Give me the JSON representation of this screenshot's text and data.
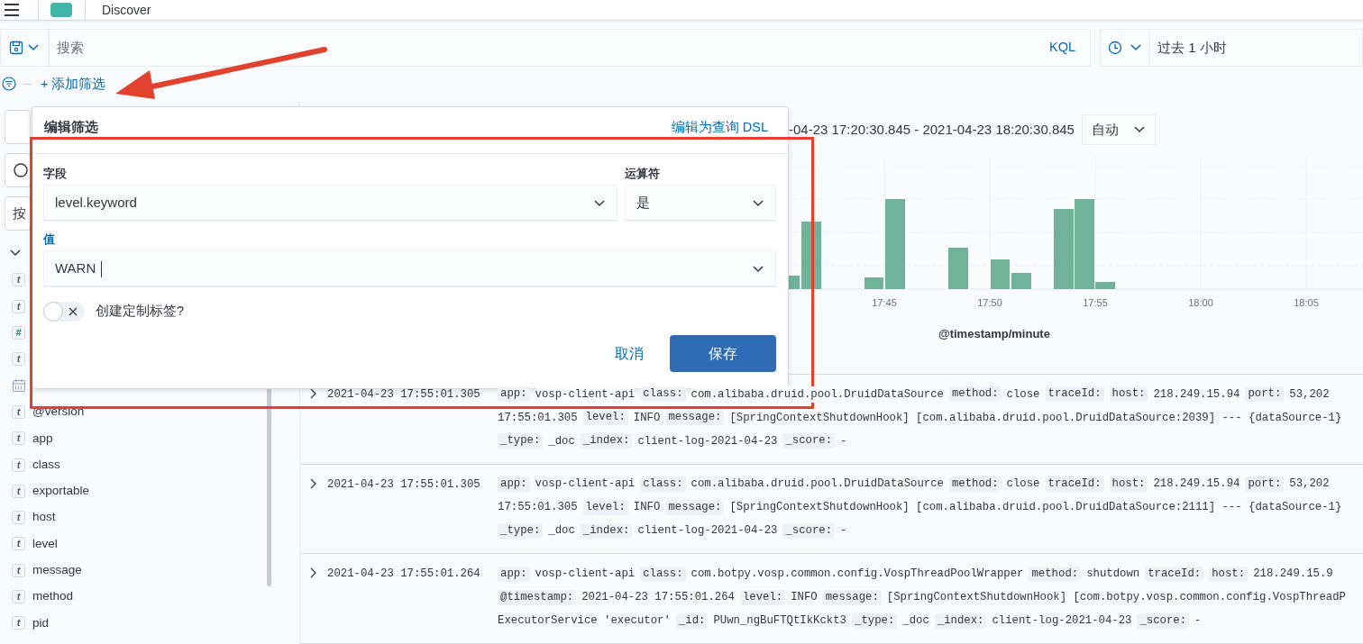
{
  "app_header": {
    "title": "Discover"
  },
  "query_bar": {
    "search": {
      "placeholder": "搜索"
    },
    "language": "KQL",
    "time_range": "过去 1 小时"
  },
  "filter_bar": {
    "add_filter": "+ 添加筛选"
  },
  "sidebar": {
    "select_text": "按",
    "fields": [
      {
        "kind": "string",
        "glyph": "t"
      },
      {
        "kind": "string",
        "glyph": "t"
      },
      {
        "kind": "number",
        "glyph": "#"
      },
      {
        "kind": "string",
        "glyph": "t"
      },
      {
        "kind": "date"
      },
      {
        "kind": "string",
        "glyph": "t",
        "name": "@version"
      },
      {
        "kind": "string",
        "glyph": "t",
        "name": "app"
      },
      {
        "kind": "string",
        "glyph": "t",
        "name": "class"
      },
      {
        "kind": "string",
        "glyph": "t",
        "name": "exportable"
      },
      {
        "kind": "string",
        "glyph": "t",
        "name": "host"
      },
      {
        "kind": "string",
        "glyph": "t",
        "name": "level"
      },
      {
        "kind": "string",
        "glyph": "t",
        "name": "message"
      },
      {
        "kind": "string",
        "glyph": "t",
        "name": "method"
      },
      {
        "kind": "string",
        "glyph": "t",
        "name": "pid"
      }
    ]
  },
  "main": {
    "date_range": "-04-23 17:20:30.845 - 2021-04-23 18:20:30.845",
    "interval": "自动",
    "histogram": {
      "x_tick_labels": [
        "17:45",
        "17:50",
        "17:55",
        "18:00",
        "18:05"
      ],
      "xlabel": "@timestamp/minute"
    },
    "documents": [
      {
        "expanded": false,
        "time": "2021-04-23 17:55:01.305",
        "lines": [
          [
            {
              "key": "app:",
              "value": "vosp-client-api"
            },
            {
              "key": "class:",
              "value": "com.alibaba.druid.pool.DruidDataSource"
            },
            {
              "key": "method:",
              "value": "close"
            },
            {
              "key": "traceId:"
            },
            {
              "key": "host:",
              "value": "218.249.15.94"
            },
            {
              "key": "port:",
              "value": "53,202"
            }
          ],
          [
            {
              "value": "17:55:01.305"
            },
            {
              "key": "level:",
              "value": "INFO"
            },
            {
              "key": "message:",
              "value": "[SpringContextShutdownHook] [com.alibaba.druid.pool.DruidDataSource:2039] --- {dataSource-1}"
            }
          ],
          [
            {
              "key": "_type:",
              "value": "_doc"
            },
            {
              "key": "_index:",
              "value": "client-log-2021-04-23"
            },
            {
              "key": "_score:",
              "value": "-"
            }
          ]
        ]
      },
      {
        "expanded": false,
        "time": "2021-04-23 17:55:01.305",
        "lines": [
          [
            {
              "key": "app:",
              "value": "vosp-client-api"
            },
            {
              "key": "class:",
              "value": "com.alibaba.druid.pool.DruidDataSource"
            },
            {
              "key": "method:",
              "value": "close"
            },
            {
              "key": "traceId:"
            },
            {
              "key": "host:",
              "value": "218.249.15.94"
            },
            {
              "key": "port:",
              "value": "53,202"
            }
          ],
          [
            {
              "value": "17:55:01.305"
            },
            {
              "key": "level:",
              "value": "INFO"
            },
            {
              "key": "message:",
              "value": "[SpringContextShutdownHook] [com.alibaba.druid.pool.DruidDataSource:2111] --- {dataSource-1}"
            }
          ],
          [
            {
              "key": "_type:",
              "value": "_doc"
            },
            {
              "key": "_index:",
              "value": "client-log-2021-04-23"
            },
            {
              "key": "_score:",
              "value": "-"
            }
          ]
        ]
      },
      {
        "expanded": false,
        "time": "2021-04-23 17:55:01.264",
        "lines": [
          [
            {
              "key": "app:",
              "value": "vosp-client-api"
            },
            {
              "key": "class:",
              "value": "com.botpy.vosp.common.config.VospThreadPoolWrapper"
            },
            {
              "key": "method:",
              "value": "shutdown"
            },
            {
              "key": "traceId:"
            },
            {
              "key": "host:",
              "value": "218.249.15.9"
            }
          ],
          [
            {
              "key": "@timestamp:",
              "value": "2021-04-23 17:55:01.264"
            },
            {
              "key": "level:",
              "value": "INFO"
            },
            {
              "key": "message:",
              "value": "[SpringContextShutdownHook] [com.botpy.vosp.common.config.VospThreadP"
            }
          ],
          [
            {
              "value": "ExecutorService 'executor'"
            },
            {
              "key": "_id:",
              "value": "PUwn_ngBuFTQtIkKckt3"
            },
            {
              "key": "_type:",
              "value": "_doc"
            },
            {
              "key": "_index:",
              "value": "client-log-2021-04-23"
            },
            {
              "key": "_score:",
              "value": "-"
            }
          ]
        ]
      }
    ]
  },
  "filter_editor": {
    "title": "编辑筛选",
    "dsl_link": "编辑为查询 DSL",
    "field": {
      "label": "字段",
      "value": "level.keyword"
    },
    "operator": {
      "label": "运算符",
      "value": "是"
    },
    "value": {
      "label": "值",
      "value": "WARN",
      "focused": true
    },
    "custom_label": {
      "label": "创建定制标签?",
      "on": false
    },
    "cancel": "取消",
    "save": "保存"
  }
}
